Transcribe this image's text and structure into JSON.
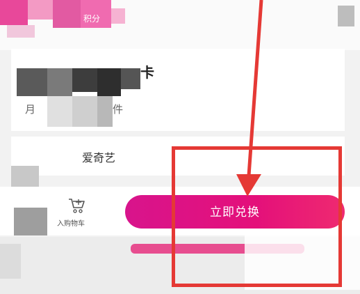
{
  "header": {
    "points_label": "积分"
  },
  "card": {
    "title": "卡",
    "fragment_left": "月",
    "fragment_right": "件"
  },
  "option": {
    "label": "爱奇艺"
  },
  "bottom_bar": {
    "cart_label": "入购物车",
    "redeem_label": "立即兑换",
    "redeem_color": "#e4107a"
  },
  "annotation": {
    "color": "#e53935"
  }
}
